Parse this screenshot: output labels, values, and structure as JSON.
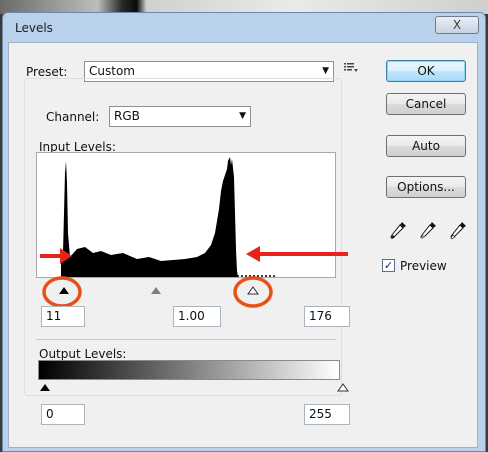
{
  "window": {
    "title": "Levels",
    "close_glyph": "X"
  },
  "preset": {
    "label": "Preset:",
    "value": "Custom",
    "menu_icon": "preset-options-icon"
  },
  "channel": {
    "label": "Channel:",
    "value": "RGB"
  },
  "input_levels": {
    "label": "Input Levels:",
    "black": "11",
    "gamma": "1.00",
    "white": "176"
  },
  "output_levels": {
    "label": "Output Levels:",
    "black": "0",
    "white": "255"
  },
  "buttons": {
    "ok": "OK",
    "cancel": "Cancel",
    "auto": "Auto",
    "options": "Options..."
  },
  "preview": {
    "label": "Preview",
    "checked": true
  },
  "annotations": {
    "arrow_color": "#e8231a",
    "circle_color": "#e8501a"
  },
  "icons": [
    "close-icon",
    "dropdown-arrow-icon",
    "black-eyedropper-icon",
    "gray-eyedropper-icon",
    "white-eyedropper-icon"
  ]
}
